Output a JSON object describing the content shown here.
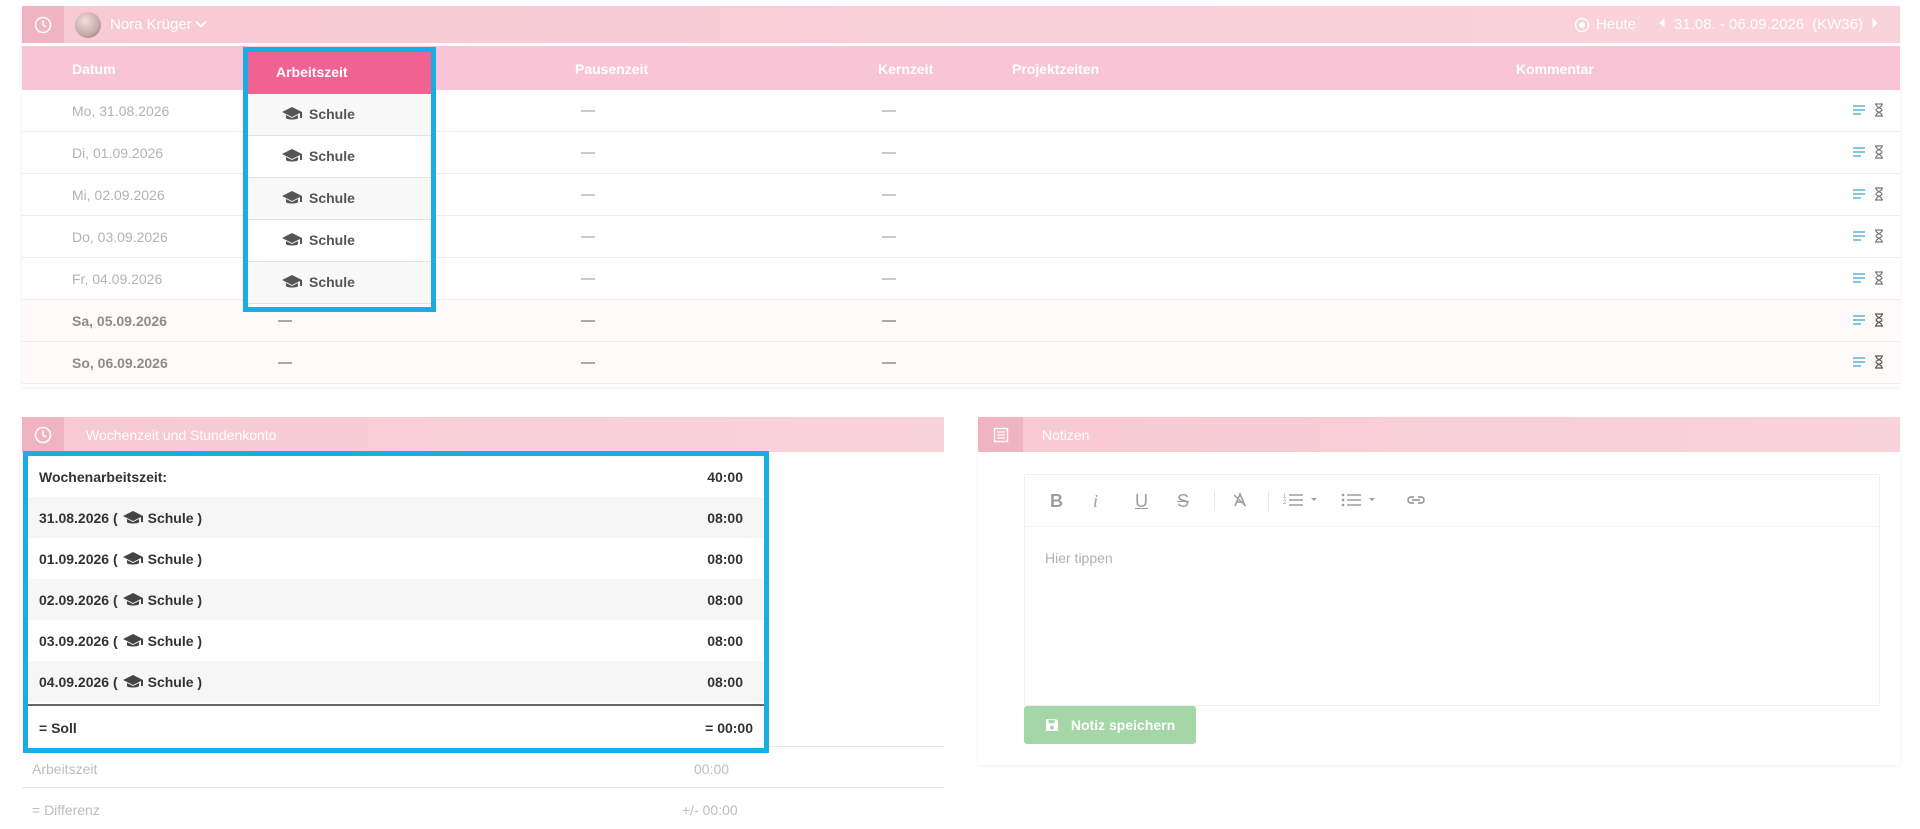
{
  "topbar": {
    "user_name": "Nora Krüger",
    "today_label": "Heute",
    "week_range": "31.08. - 06.09.2026",
    "week_number": "(KW36)"
  },
  "table": {
    "columns": [
      "Datum",
      "Arbeitszeit",
      "Pausenzeit",
      "Kernzeit",
      "Projektzeiten",
      "Kommentar"
    ],
    "rows": [
      {
        "date": "Mo, 31.08.2026",
        "arbeitszeit": "Schule",
        "weekend": false
      },
      {
        "date": "Di, 01.09.2026",
        "arbeitszeit": "Schule",
        "weekend": false
      },
      {
        "date": "Mi, 02.09.2026",
        "arbeitszeit": "Schule",
        "weekend": false
      },
      {
        "date": "Do, 03.09.2026",
        "arbeitszeit": "Schule",
        "weekend": false
      },
      {
        "date": "Fr, 04.09.2026",
        "arbeitszeit": "Schule",
        "weekend": false
      },
      {
        "date": "Sa, 05.09.2026",
        "arbeitszeit": "",
        "weekend": true
      },
      {
        "date": "So, 06.09.2026",
        "arbeitszeit": "",
        "weekend": true
      }
    ]
  },
  "weekly": {
    "title": "Wochenzeit und Stundenkonto",
    "wochenarbeitszeit_label": "Wochenarbeitszeit:",
    "wochenarbeitszeit_value": "40:00",
    "days": [
      {
        "date": "31.08.2026 (",
        "type": "Schule )",
        "value": "08:00"
      },
      {
        "date": "01.09.2026 (",
        "type": "Schule )",
        "value": "08:00"
      },
      {
        "date": "02.09.2026 (",
        "type": "Schule )",
        "value": "08:00"
      },
      {
        "date": "03.09.2026 (",
        "type": "Schule )",
        "value": "08:00"
      },
      {
        "date": "04.09.2026 (",
        "type": "Schule )",
        "value": "08:00"
      }
    ],
    "soll_label": "= Soll",
    "soll_value": "= 00:00",
    "arbeitszeit_label": "Arbeitszeit",
    "arbeitszeit_value": "00:00",
    "differenz_label": "= Differenz",
    "differenz_value": "+/- 00:00"
  },
  "notes": {
    "title": "Notizen",
    "placeholder": "Hier tippen",
    "save_label": "Notiz speichern"
  },
  "colors": {
    "accent_pink": "#f06292",
    "highlight_blue": "#1aade3",
    "save_green": "#a5d6a7"
  }
}
